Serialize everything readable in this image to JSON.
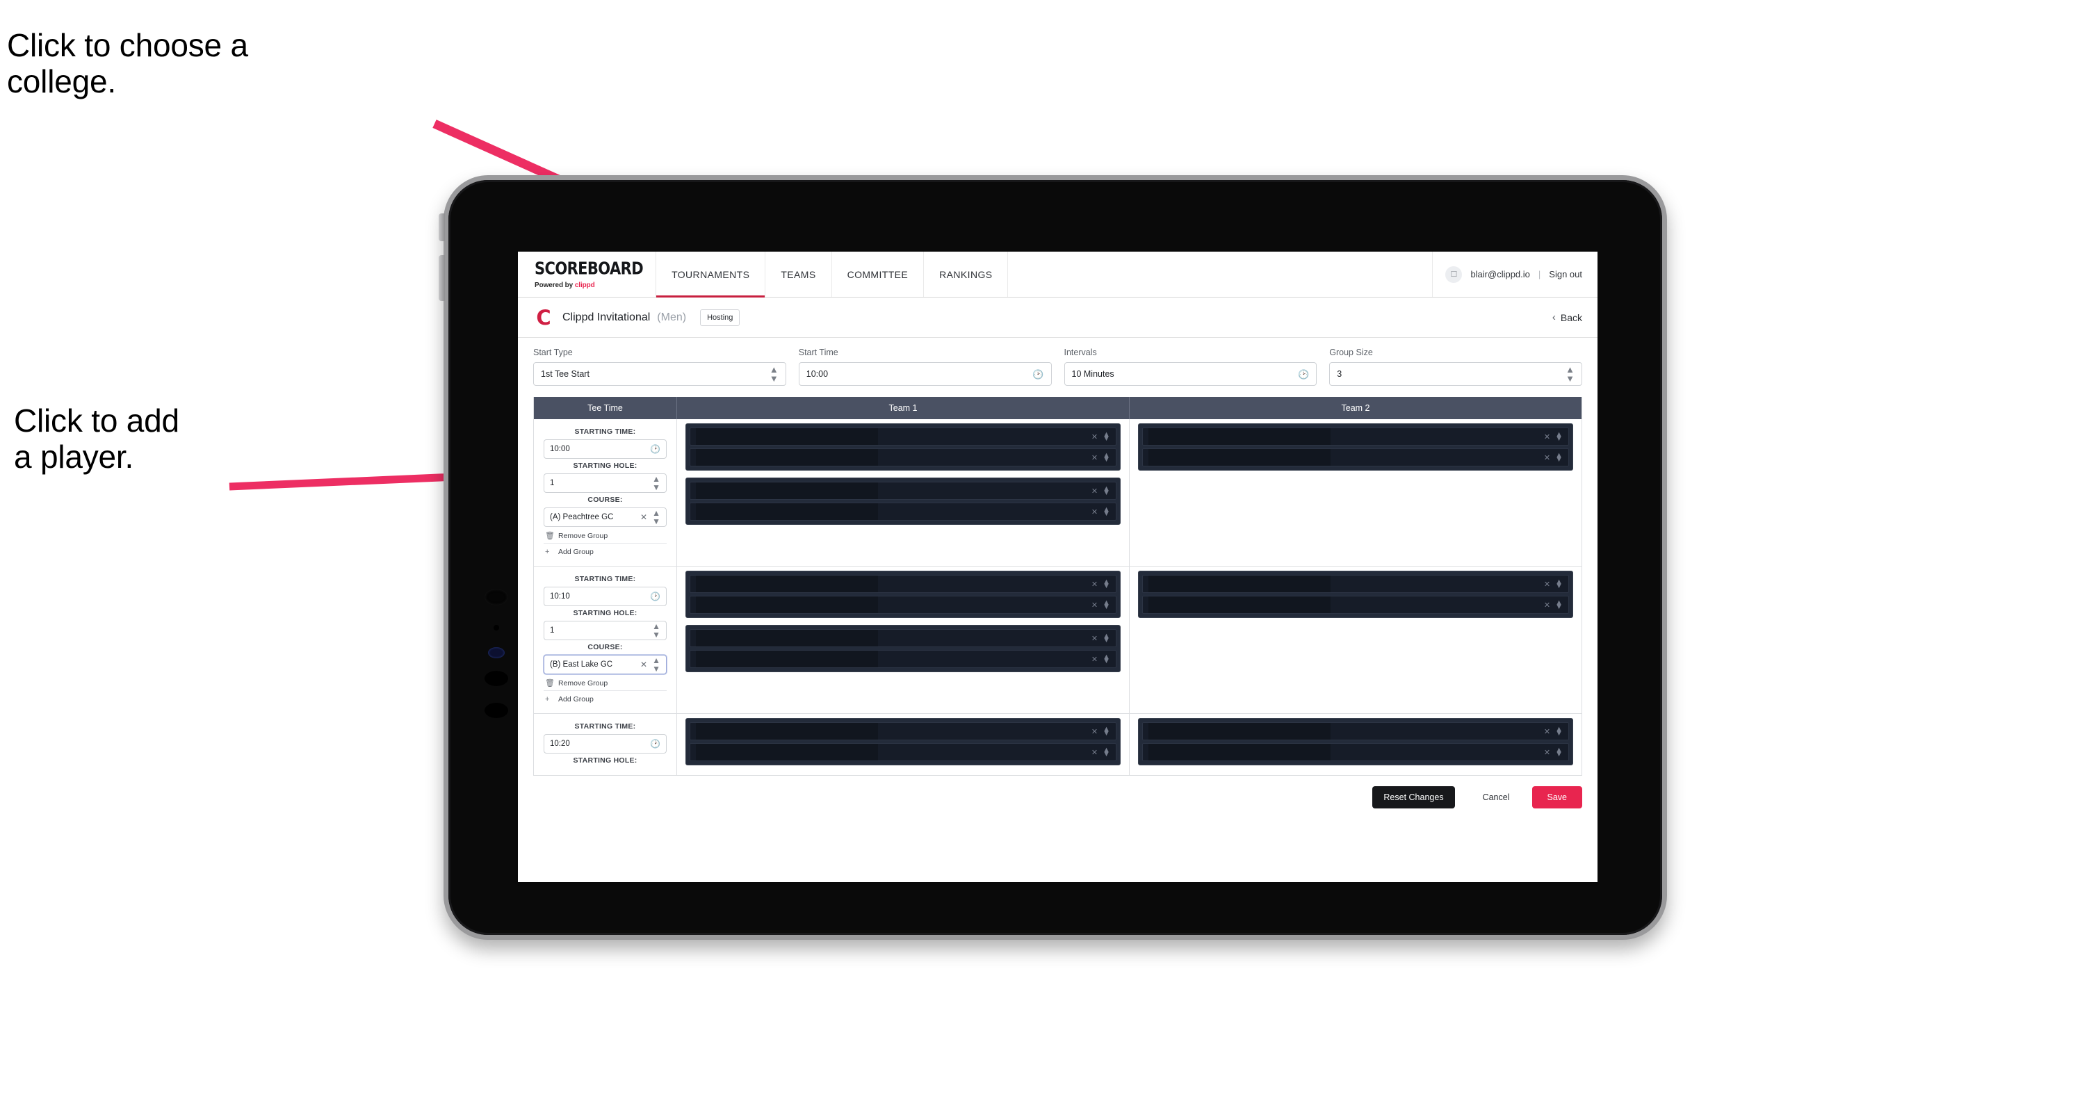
{
  "annotations": {
    "college": "Click to choose a\ncollege.",
    "player": "Click to add\na player.",
    "arrow_color": "#ed2e63"
  },
  "nav": {
    "brand_word": "SCOREBOARD",
    "brand_sub_prefix": "Powered by ",
    "brand_sub_accent": "clippd",
    "tabs": [
      {
        "label": "TOURNAMENTS",
        "active": true
      },
      {
        "label": "TEAMS",
        "active": false
      },
      {
        "label": "COMMITTEE",
        "active": false
      },
      {
        "label": "RANKINGS",
        "active": false
      }
    ],
    "user_email": "blair@clippd.io",
    "separator": "|",
    "sign_out": "Sign out",
    "avatar_icon": "user-avatar-icon"
  },
  "title_bar": {
    "logo_glyph": "C",
    "tournament_name": "Clippd Invitational",
    "gender": "(Men)",
    "badge": "Hosting",
    "back_label": "Back",
    "back_chevron": "‹"
  },
  "controls": [
    {
      "label": "Start Type",
      "value": "1st Tee Start",
      "adorn": "stepper"
    },
    {
      "label": "Start Time",
      "value": "10:00",
      "adorn": "clock"
    },
    {
      "label": "Intervals",
      "value": "10 Minutes",
      "adorn": "clock"
    },
    {
      "label": "Group Size",
      "value": "3",
      "adorn": "stepper"
    }
  ],
  "grid": {
    "headers": [
      "Tee Time",
      "Team 1",
      "Team 2"
    ],
    "labels": {
      "starting_time": "STARTING TIME:",
      "starting_hole": "STARTING HOLE:",
      "course": "COURSE:",
      "remove_group": "Remove Group",
      "add_group": "Add Group",
      "remove_icon": "trash-icon",
      "add_icon": "plus-icon",
      "clock_icon": "clock-icon",
      "clear_icon": "x-icon",
      "stepper_icon": "stepper-icon"
    },
    "rows": [
      {
        "starting_time": "10:00",
        "starting_hole": "1",
        "course": "(A) Peachtree GC",
        "course_focused": false,
        "team1_groups": [
          {
            "slots": [
              {
                "redact_pct": 44
              },
              {
                "redact_pct": 44
              }
            ]
          },
          {
            "slots": [
              {
                "redact_pct": 44
              },
              {
                "redact_pct": 44
              }
            ]
          }
        ],
        "team2_groups": [
          {
            "slots": [
              {
                "redact_pct": 44
              },
              {
                "redact_pct": 44
              }
            ]
          }
        ]
      },
      {
        "starting_time": "10:10",
        "starting_hole": "1",
        "course": "(B) East Lake GC",
        "course_focused": true,
        "team1_groups": [
          {
            "slots": [
              {
                "redact_pct": 44
              },
              {
                "redact_pct": 44
              }
            ]
          },
          {
            "slots": [
              {
                "redact_pct": 44
              },
              {
                "redact_pct": 44
              }
            ]
          }
        ],
        "team2_groups": [
          {
            "slots": [
              {
                "redact_pct": 44
              },
              {
                "redact_pct": 44
              }
            ]
          }
        ]
      },
      {
        "starting_time": "10:20",
        "starting_hole": "",
        "course": "",
        "course_focused": false,
        "partial": true,
        "team1_groups": [
          {
            "slots": [
              {
                "redact_pct": 44
              },
              {
                "redact_pct": 44
              }
            ]
          }
        ],
        "team2_groups": [
          {
            "slots": [
              {
                "redact_pct": 44
              },
              {
                "redact_pct": 44
              }
            ]
          }
        ]
      }
    ]
  },
  "footer": {
    "reset_label": "Reset Changes",
    "cancel_label": "Cancel",
    "save_label": "Save",
    "save_color": "#e8254f"
  }
}
